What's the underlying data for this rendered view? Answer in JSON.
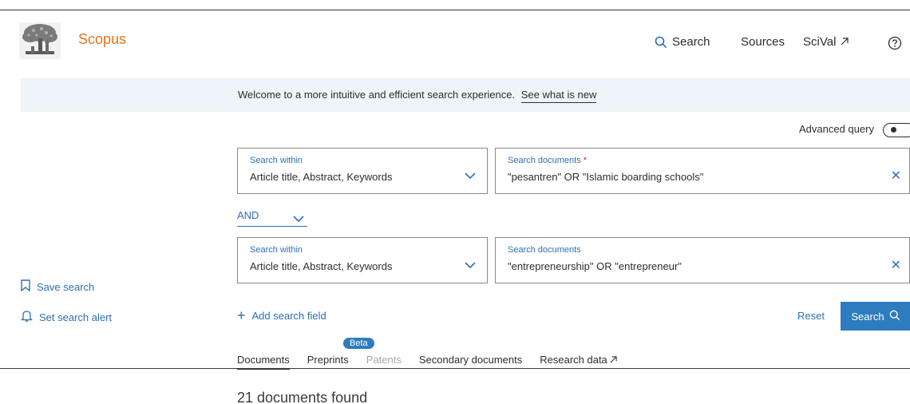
{
  "header": {
    "brand": "Scopus",
    "logo_icon": "elsevier-tree-logo",
    "nav": {
      "search": "Search",
      "sources": "Sources",
      "scival": "SciVal"
    },
    "help_icon": "help-circle-icon"
  },
  "banner": {
    "text": "Welcome to a more intuitive and efficient search experience.",
    "link": "See what is new"
  },
  "advanced_query": {
    "label": "Advanced query",
    "enabled": false
  },
  "search_rows": [
    {
      "within_label": "Search within",
      "within_value": "Article title, Abstract, Keywords",
      "docs_label": "Search documents",
      "docs_required": "*",
      "docs_value": "\"pesantren\" OR \"Islamic boarding schools\""
    },
    {
      "within_label": "Search within",
      "within_value": "Article title, Abstract, Keywords",
      "docs_label": "Search documents",
      "docs_value": "\"entrepreneurship\" OR \"entrepreneur\""
    }
  ],
  "operator": {
    "value": "AND"
  },
  "left_actions": {
    "save_search": "Save search",
    "set_alert": "Set search alert"
  },
  "actions": {
    "add_field": "Add search field",
    "reset": "Reset",
    "search": "Search"
  },
  "tabs": [
    {
      "label": "Documents",
      "state": "active"
    },
    {
      "label": "Preprints",
      "state": "normal",
      "badge": "Beta"
    },
    {
      "label": "Patents",
      "state": "disabled"
    },
    {
      "label": "Secondary documents",
      "state": "normal"
    },
    {
      "label": "Research data",
      "state": "normal"
    }
  ],
  "results": {
    "count_text": "21 documents found"
  },
  "colors": {
    "brand_orange": "#e9711c",
    "link_blue": "#2e6fb5",
    "button_blue": "#2e7cc0",
    "banner_bg": "#edf4fa"
  }
}
